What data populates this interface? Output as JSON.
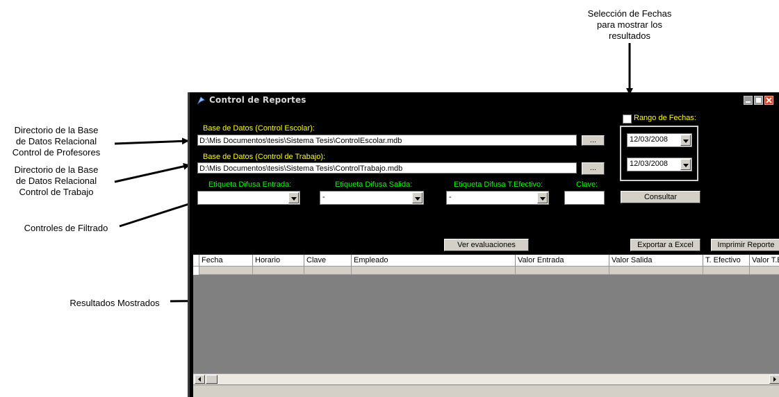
{
  "annotations": {
    "top_right": [
      "Selección de Fechas",
      "para mostrar los",
      "resultados"
    ],
    "dir_escolar": [
      "Directorio de la Base",
      "de Datos Relacional",
      "Control de Profesores"
    ],
    "dir_trabajo": [
      "Directorio de la Base",
      "de Datos Relacional",
      "Control de Trabajo"
    ],
    "filtros": "Controles de Filtrado",
    "resultados": "Resultados Mostrados"
  },
  "window": {
    "title": "Control de Reportes"
  },
  "db_escolar": {
    "label": "Base de Datos (Control Escolar):",
    "path": "D:\\Mis Documentos\\tesis\\Sistema Tesis\\ControlEscolar.mdb",
    "browse_label": "..."
  },
  "db_trabajo": {
    "label": "Base de Datos (Control de Trabajo):",
    "path": "D:\\Mis Documentos\\tesis\\Sistema Tesis\\ControlTrabajo.mdb",
    "browse_label": "..."
  },
  "filters": {
    "entrada_label": "Etiqueta Difusa Entrada:",
    "entrada_value": "",
    "salida_label": "Etiqueta Difusa Salida:",
    "salida_value": "-",
    "efectivo_label": "Etiqueta Difusa T.Efectivo:",
    "efectivo_value": "-",
    "clave_label": "Clave:",
    "clave_value": ""
  },
  "dates": {
    "range_label": "Rango de Fechas:",
    "range_checked": false,
    "from": "12/03/2008",
    "to": "12/03/2008"
  },
  "buttons": {
    "consultar": "Consultar",
    "ver_evaluaciones": "Ver evaluaciones",
    "exportar": "Exportar a Excel",
    "imprimir": "Imprimir Reporte"
  },
  "grid": {
    "columns": [
      "Fecha",
      "Horario",
      "Clave",
      "Empleado",
      "Valor Entrada",
      "Valor Salida",
      "T. Efectivo",
      "Valor T.E"
    ],
    "rows": []
  },
  "colors": {
    "window_bg": "#000000",
    "label_yellow": "#ffff00",
    "label_green": "#00ff00",
    "grid_bg": "#808080",
    "close_red": "#e03a1e"
  }
}
